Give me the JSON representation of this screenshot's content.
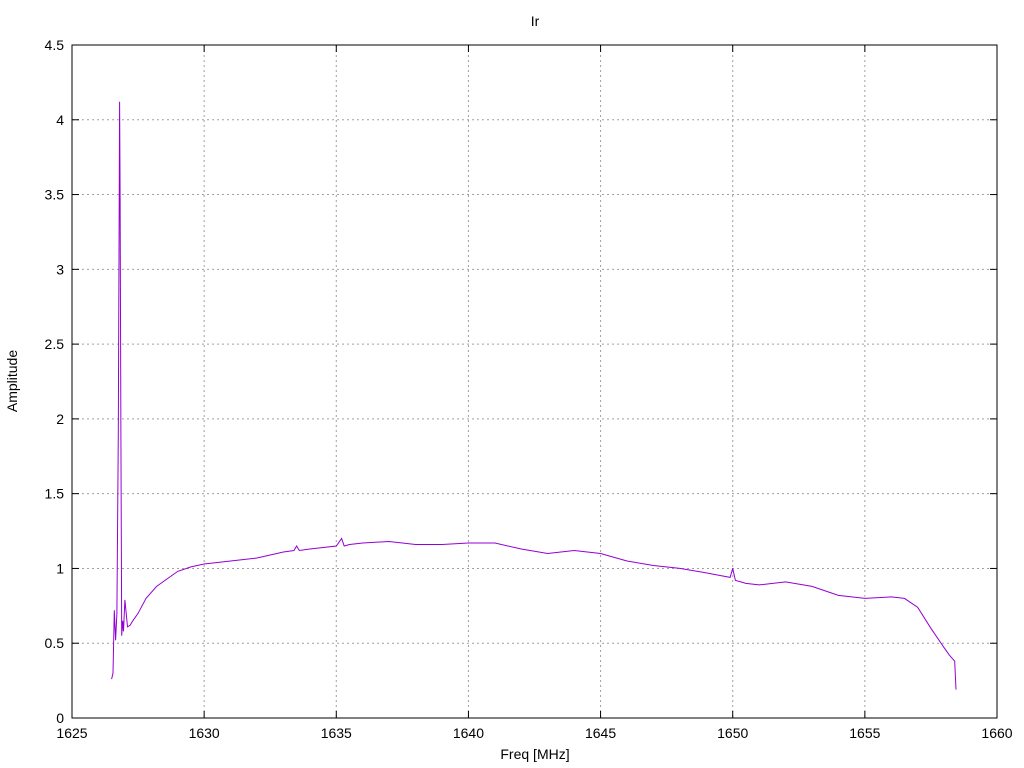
{
  "chart_data": {
    "type": "line",
    "title": "Ir",
    "xlabel": "Freq [MHz]",
    "ylabel": "Amplitude",
    "xlim": [
      1625,
      1660
    ],
    "ylim": [
      0,
      4.5
    ],
    "grid": true,
    "x_ticks": [
      1625,
      1630,
      1635,
      1640,
      1645,
      1650,
      1655,
      1660
    ],
    "x_tick_labels": [
      "1625",
      "1630",
      "1635",
      "1640",
      "1645",
      "1650",
      "1655",
      "1660"
    ],
    "y_ticks": [
      0,
      0.5,
      1,
      1.5,
      2,
      2.5,
      3,
      3.5,
      4,
      4.5
    ],
    "y_tick_labels": [
      "0",
      "0.5",
      "1",
      "1.5",
      "2",
      "2.5",
      "3",
      "3.5",
      "4",
      "4.5"
    ],
    "series": [
      {
        "color": "#9400d3",
        "x": [
          1626.5,
          1626.55,
          1626.6,
          1626.65,
          1626.7,
          1626.75,
          1626.8,
          1626.82,
          1626.85,
          1626.88,
          1626.92,
          1626.95,
          1627.0,
          1627.05,
          1627.1,
          1627.2,
          1627.3,
          1627.5,
          1627.8,
          1628.2,
          1628.6,
          1629.0,
          1629.5,
          1630.0,
          1630.5,
          1631.0,
          1632.0,
          1633.0,
          1633.4,
          1633.5,
          1633.6,
          1634.0,
          1635.0,
          1635.2,
          1635.3,
          1635.5,
          1636.0,
          1637.0,
          1638.0,
          1639.0,
          1640.0,
          1641.0,
          1642.0,
          1643.0,
          1644.0,
          1645.0,
          1646.0,
          1647.0,
          1648.0,
          1649.0,
          1649.9,
          1650.0,
          1650.1,
          1650.5,
          1651.0,
          1652.0,
          1653.0,
          1654.0,
          1655.0,
          1656.0,
          1656.5,
          1657.0,
          1657.5,
          1658.0,
          1658.2,
          1658.4,
          1658.45
        ],
        "y": [
          0.26,
          0.3,
          0.72,
          0.52,
          0.7,
          1.9,
          4.12,
          3.5,
          1.9,
          0.55,
          0.65,
          0.58,
          0.79,
          0.7,
          0.61,
          0.62,
          0.65,
          0.7,
          0.8,
          0.88,
          0.93,
          0.98,
          1.01,
          1.03,
          1.04,
          1.05,
          1.07,
          1.11,
          1.12,
          1.15,
          1.12,
          1.13,
          1.15,
          1.2,
          1.15,
          1.16,
          1.17,
          1.18,
          1.16,
          1.16,
          1.17,
          1.17,
          1.13,
          1.1,
          1.12,
          1.1,
          1.05,
          1.02,
          1.0,
          0.97,
          0.94,
          1.0,
          0.92,
          0.9,
          0.89,
          0.91,
          0.88,
          0.82,
          0.8,
          0.81,
          0.8,
          0.74,
          0.6,
          0.47,
          0.42,
          0.38,
          0.19
        ]
      }
    ]
  }
}
